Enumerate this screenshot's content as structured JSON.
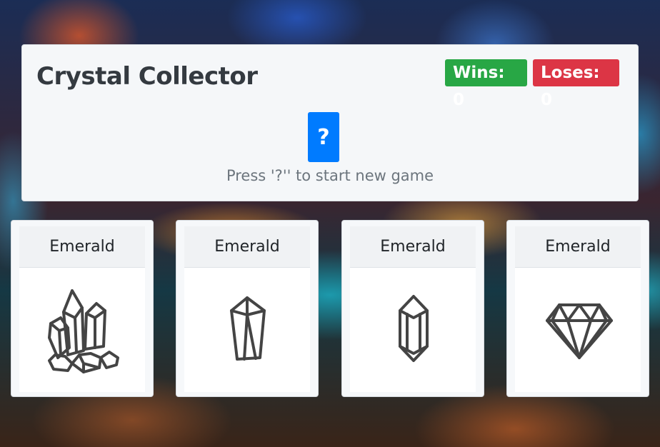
{
  "game": {
    "title": "Crystal Collector",
    "wins_label": "Wins: 0",
    "loses_label": "Loses: 0",
    "new_game_button": "?",
    "hint": "Press '?'' to start new game"
  },
  "crystals": [
    {
      "label": "Emerald",
      "icon": "crystal-cluster-icon"
    },
    {
      "label": "Emerald",
      "icon": "long-gem-icon"
    },
    {
      "label": "Emerald",
      "icon": "hexagonal-crystal-icon"
    },
    {
      "label": "Emerald",
      "icon": "diamond-icon"
    }
  ],
  "colors": {
    "wins": "#28a745",
    "loses": "#dc3545",
    "button": "#007bff",
    "icon_stroke": "#444444"
  }
}
